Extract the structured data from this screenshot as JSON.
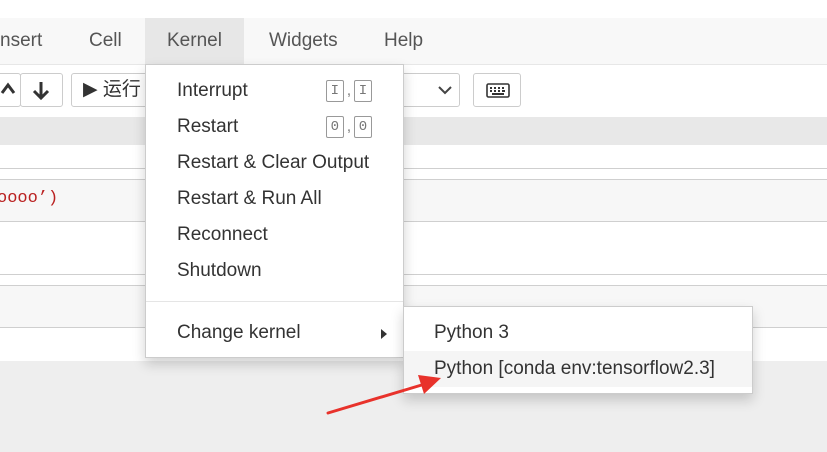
{
  "menubar": {
    "items": [
      {
        "label": "nsert"
      },
      {
        "label": "Cell"
      },
      {
        "label": "Kernel"
      },
      {
        "label": "Widgets"
      },
      {
        "label": "Help"
      }
    ]
  },
  "toolbar": {
    "run_label": "▶ 运行",
    "up_icon": "arrow-up-icon",
    "down_icon": "arrow-down-icon",
    "keyboard_icon": "keyboard-icon",
    "celltype_caret": "chevron-down-icon"
  },
  "notebook": {
    "code_fragment": "oooo’)"
  },
  "kernel_menu": {
    "items": [
      {
        "label": "Interrupt",
        "shortcut": [
          "I",
          "I"
        ]
      },
      {
        "label": "Restart",
        "shortcut": [
          "0",
          "0"
        ]
      },
      {
        "label": "Restart & Clear Output"
      },
      {
        "label": "Restart & Run All"
      },
      {
        "label": "Reconnect"
      },
      {
        "label": "Shutdown"
      }
    ],
    "change_kernel_label": "Change kernel"
  },
  "change_kernel_submenu": {
    "items": [
      {
        "label": "Python 3"
      },
      {
        "label": "Python [conda env:tensorflow2.3]"
      }
    ],
    "highlighted_index": 1
  },
  "colors": {
    "annotation_arrow": "#e8322b",
    "active_menu_bg": "#e7e7e7",
    "hover_bg": "#f5f5f5"
  }
}
